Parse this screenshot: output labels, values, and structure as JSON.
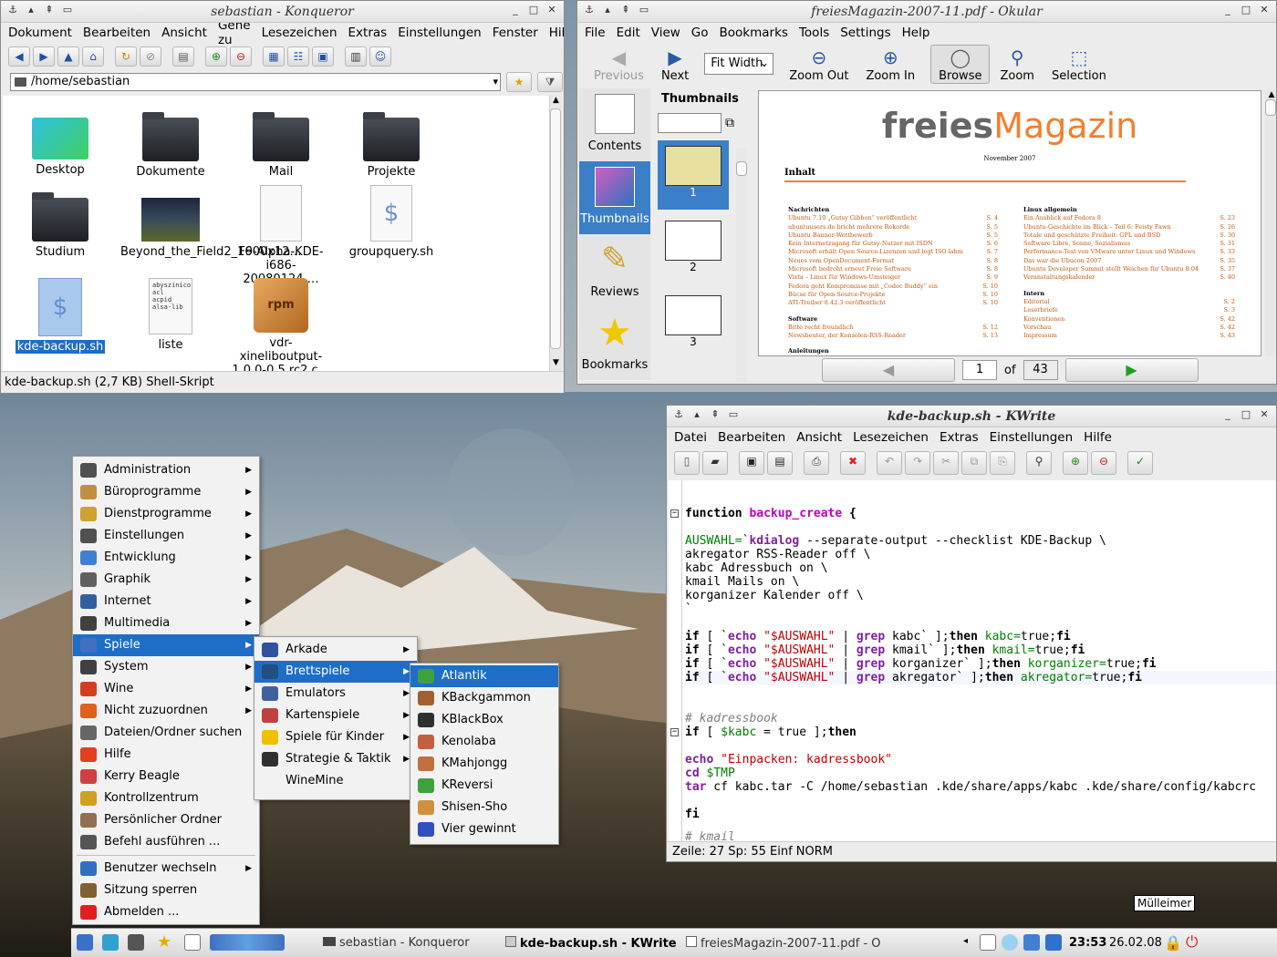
{
  "konqueror": {
    "title": "sebastian - Konqueror",
    "menu": [
      "Dokument",
      "Bearbeiten",
      "Ansicht",
      "Gehe zu",
      "Lesezeichen",
      "Extras",
      "Einstellungen",
      "Fenster",
      "Hilfe"
    ],
    "location": "/home/sebastian",
    "files": [
      {
        "label": "Desktop",
        "type": "desktop"
      },
      {
        "label": "Dokumente",
        "type": "folder"
      },
      {
        "label": "Mail",
        "type": "folder"
      },
      {
        "label": "Projekte",
        "type": "folder"
      },
      {
        "label": "Studium",
        "type": "folder"
      },
      {
        "label": "Beyond_the_Field2_1600x12…",
        "type": "image"
      },
      {
        "label": "F9-Alpha-KDE-i686-20080124.…",
        "type": "doc"
      },
      {
        "label": "groupquery.sh",
        "type": "script"
      },
      {
        "label": "kde-backup.sh",
        "type": "script"
      },
      {
        "label": "liste",
        "type": "text"
      },
      {
        "label": "vdr-xineliboutput-1.0.0-0.5.rc2.c…",
        "type": "rpm"
      }
    ],
    "status": "kde-backup.sh (2,7 KB)  Shell-Skript"
  },
  "okular": {
    "title": "freiesMagazin-2007-11.pdf - Okular",
    "menu": [
      "File",
      "Edit",
      "View",
      "Go",
      "Bookmarks",
      "Tools",
      "Settings",
      "Help"
    ],
    "toolbar": {
      "previous": "Previous",
      "next": "Next",
      "fit": "Fit Width",
      "zoom_out": "Zoom Out",
      "zoom_in": "Zoom In",
      "browse": "Browse",
      "zoom": "Zoom",
      "selection": "Selection"
    },
    "side": [
      "Contents",
      "Thumbnails",
      "Reviews",
      "Bookmarks"
    ],
    "thumbnails_title": "Thumbnails",
    "thumb_pages": [
      "1",
      "2",
      "3"
    ],
    "page": {
      "brand1": "freies",
      "brand2": "Magazin",
      "date": "November 2007",
      "heading": "Inhalt",
      "left_col": [
        {
          "section": "Nachrichten"
        },
        {
          "t": "Ubuntu 7.10 „Gutsy Gibbon“ veröffentlicht",
          "p": "S. 4"
        },
        {
          "t": "ubuntuusers.de bricht mehrere Rekorde",
          "p": "S. 5"
        },
        {
          "t": "Ubuntu Banner-Wettbewerb",
          "p": "S. 5"
        },
        {
          "t": "Kein Internetzugang für Gutsy-Nutzer mit ISDN",
          "p": "S. 6"
        },
        {
          "t": "Microsoft erhält Open Source-Lizenzen und legt ISO lahm",
          "p": "S. 7"
        },
        {
          "t": "Neues vom OpenDocument-Format",
          "p": "S. 8"
        },
        {
          "t": "Microsoft bedroht erneut Freie Software",
          "p": "S. 8"
        },
        {
          "t": "Vixta – Linux für Windows-Umsteiger",
          "p": "S. 9"
        },
        {
          "t": "Fedora geht Kompromisse mit „Codec Buddy“ ein",
          "p": "S. 10"
        },
        {
          "t": "Bücse für Open-Source-Projekte",
          "p": "S. 10"
        },
        {
          "t": "ATI-Treiber 8.42.3 veröffentlicht",
          "p": "S. 10"
        },
        {
          "section": "Software"
        },
        {
          "t": "Bitte recht freundlich",
          "p": "S. 12"
        },
        {
          "t": "Newsbeuter, der Konsolen-RSS-Reader",
          "p": "S. 13"
        },
        {
          "section": "Anleitungen"
        }
      ],
      "right_col": [
        {
          "section": "Linux allgemein"
        },
        {
          "t": "Ein Ausblick auf Fedora 8",
          "p": "S. 23"
        },
        {
          "t": "Ubuntu-Geschichte im Blick – Teil 6: Feisty Fawn",
          "p": "S. 26"
        },
        {
          "t": "Totale und geschützte Freiheit: GPL und BSD",
          "p": "S. 30"
        },
        {
          "t": "Software Libre, Sonne, Sozialismus",
          "p": "S. 31"
        },
        {
          "t": "Performance-Test von VMware unter Linux und Windows",
          "p": "S. 33"
        },
        {
          "t": "Das war die Ubucon 2007",
          "p": "S. 35"
        },
        {
          "t": "Ubuntu Developer Summit stellt Weichen für Ubuntu 8.04",
          "p": "S. 37"
        },
        {
          "t": "Veranstaltungskalender",
          "p": "S. 40"
        },
        {
          "section": "Intern"
        },
        {
          "t": "Editorial",
          "p": "S. 2"
        },
        {
          "t": "Leserbriefe",
          "p": "S. 3"
        },
        {
          "t": "Konventionen",
          "p": "S. 42"
        },
        {
          "t": "Vorschau",
          "p": "S. 42"
        },
        {
          "t": "Impressum",
          "p": "S. 43"
        }
      ]
    },
    "page_current": "1",
    "page_of": "of",
    "page_total": "43"
  },
  "kwrite": {
    "title": "kde-backup.sh - KWrite",
    "menu": [
      "Datei",
      "Bearbeiten",
      "Ansicht",
      "Lesezeichen",
      "Extras",
      "Einstellungen",
      "Hilfe"
    ],
    "status": "Zeile: 27 Sp: 55  Einf  NORM"
  },
  "kmenu": {
    "main": [
      "Administration",
      "Büroprogramme",
      "Dienstprogramme",
      "Einstellungen",
      "Entwicklung",
      "Graphik",
      "Internet",
      "Multimedia",
      "Spiele",
      "System",
      "Wine",
      "Nicht zuzuordnen",
      "Dateien/Ordner suchen",
      "Hilfe",
      "Kerry Beagle",
      "Kontrollzentrum",
      "Persönlicher Ordner",
      "Befehl ausführen ...",
      "Benutzer wechseln",
      "Sitzung sperren",
      "Abmelden ..."
    ],
    "games": [
      "Arkade",
      "Brettspiele",
      "Emulators",
      "Kartenspiele",
      "Spiele für Kinder",
      "Strategie & Taktik",
      "WineMine"
    ],
    "board": [
      "Atlantik",
      "KBackgammon",
      "KBlackBox",
      "Kenolaba",
      "KMahjongg",
      "KReversi",
      "Shisen-Sho",
      "Vier gewinnt"
    ]
  },
  "taskbar": {
    "tasks": [
      "sebastian - Konqueror",
      "kde-backup.sh - KWrite",
      "freiesMagazin-2007-11.pdf - O"
    ],
    "time": "23:53",
    "date": "26.02.08"
  },
  "desktop": {
    "trash": "Mülleimer"
  }
}
